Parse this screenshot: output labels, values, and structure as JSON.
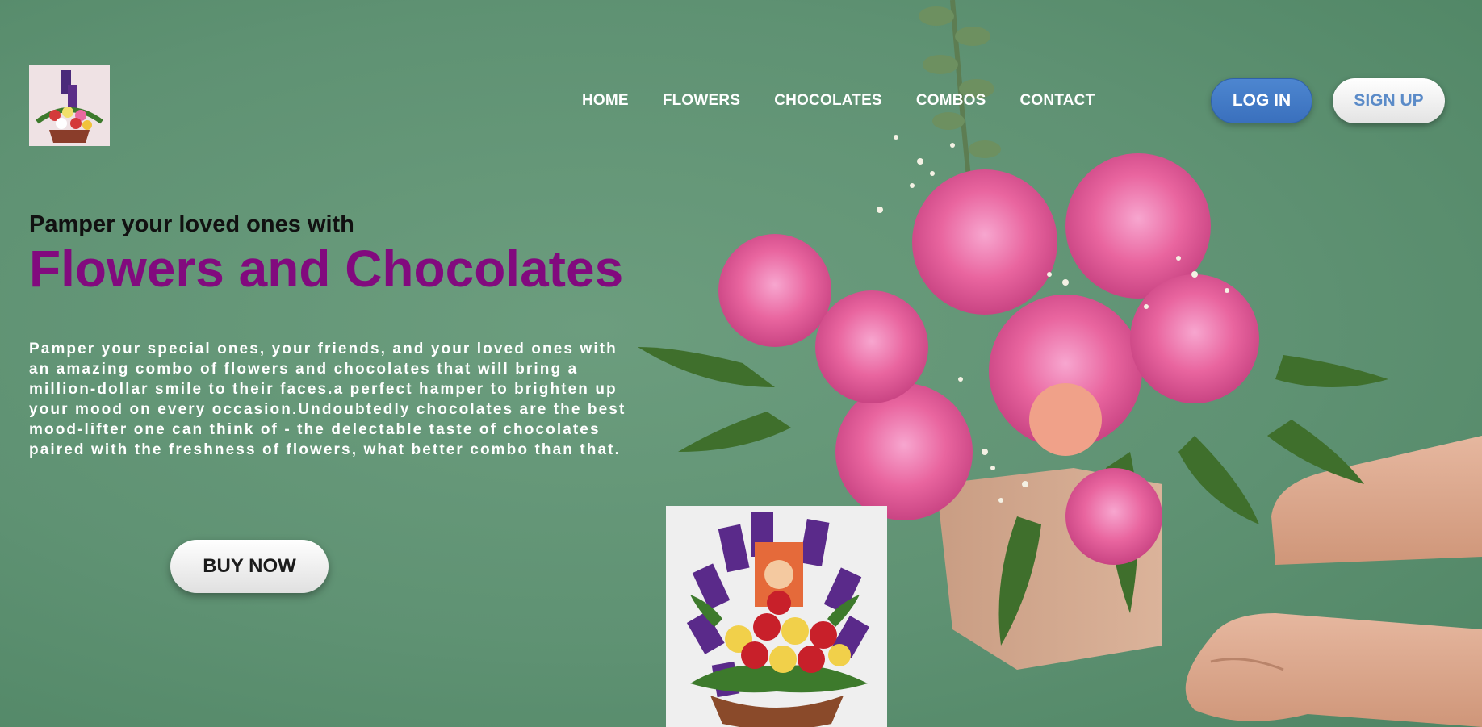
{
  "nav": {
    "items": [
      {
        "label": "HOME"
      },
      {
        "label": "FLOWERS"
      },
      {
        "label": "CHOCOLATES"
      },
      {
        "label": "COMBOS"
      },
      {
        "label": "CONTACT"
      }
    ]
  },
  "auth": {
    "login_label": "LOG IN",
    "signup_label": "SIGN UP"
  },
  "hero": {
    "subheading": "Pamper your loved ones with",
    "heading": "Flowers and Chocolates",
    "description": "Pamper your special ones, your friends, and your loved ones with an amazing combo of flowers and chocolates that will bring a million-dollar smile to their faces.a perfect hamper to brighten up your mood on every occasion.Undoubtedly chocolates are the best mood-lifter one can think of - the delectable taste of chocolates paired with the freshness of flowers, what better combo than that.",
    "buy_label": "BUY NOW"
  },
  "colors": {
    "background": "#5f9273",
    "heading": "#820a7e",
    "login_button": "#3a70bd",
    "signup_text": "#5b8bc8"
  }
}
